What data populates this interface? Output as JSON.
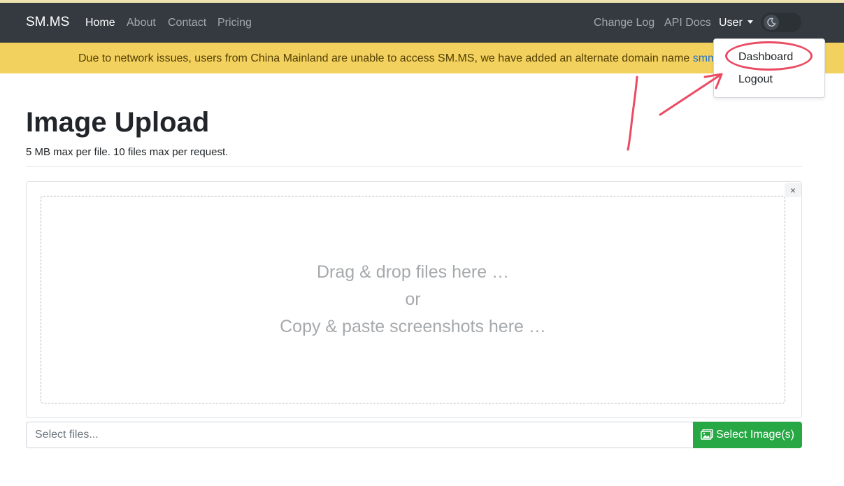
{
  "navbar": {
    "brand": "SM.MS",
    "links": [
      "Home",
      "About",
      "Contact",
      "Pricing"
    ],
    "right_links": [
      "Change Log",
      "API Docs"
    ],
    "user_menu": "User",
    "theme_toggle_icon": "moon-icon"
  },
  "alert": {
    "text": "Due to network issues, users from China Mainland are unable to access SM.MS, we have added an alternate domain name ",
    "link": "smms.app"
  },
  "dropdown": {
    "items": [
      "Dashboard",
      "Logout"
    ]
  },
  "main": {
    "title": "Image Upload",
    "subtitle": "5 MB max per file. 10 files max per request."
  },
  "upload": {
    "close_symbol": "×",
    "drop_lines": [
      "Drag & drop files here …",
      "or",
      "Copy & paste screenshots here …"
    ],
    "input_placeholder": "Select files...",
    "select_button": "Select Image(s)",
    "select_icon": "images-icon"
  },
  "colors": {
    "navbar": "#343a40",
    "alert_bg": "#f2d15f",
    "link": "#1e6fd6",
    "success": "#28a745",
    "annotation": "#ea4b63"
  }
}
